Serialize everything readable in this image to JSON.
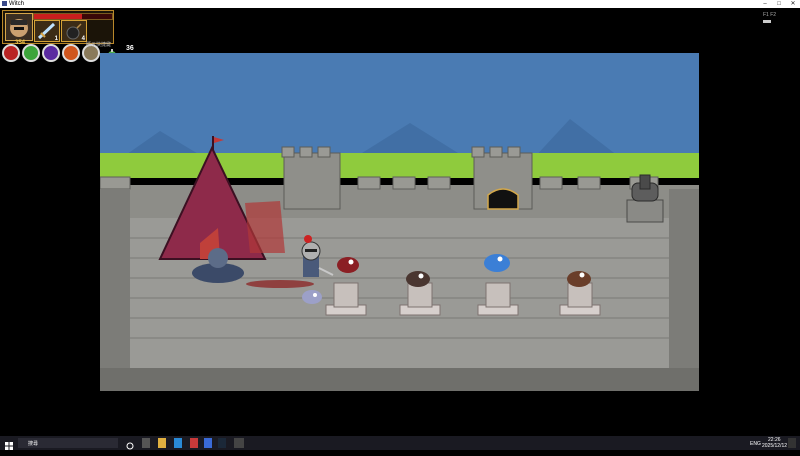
{
  "window": {
    "title": "Witch"
  },
  "hud": {
    "health_percent": 0.62,
    "score": "354",
    "sword_count": "1",
    "bomb_count": "4",
    "small_label": "顯示快捷鍵",
    "gem_count": "36",
    "top_right_label": "F1 F2"
  },
  "taskbar": {
    "search_text": "搜尋",
    "lang": "ENG",
    "time": "22:26",
    "date": "2025/12/12"
  },
  "colors": {
    "health": "#c81e1e",
    "hud_border": "#d5a236",
    "sky": "#4a7bb3",
    "grass": "#8fcb3d",
    "stone": "#9a9a96"
  }
}
